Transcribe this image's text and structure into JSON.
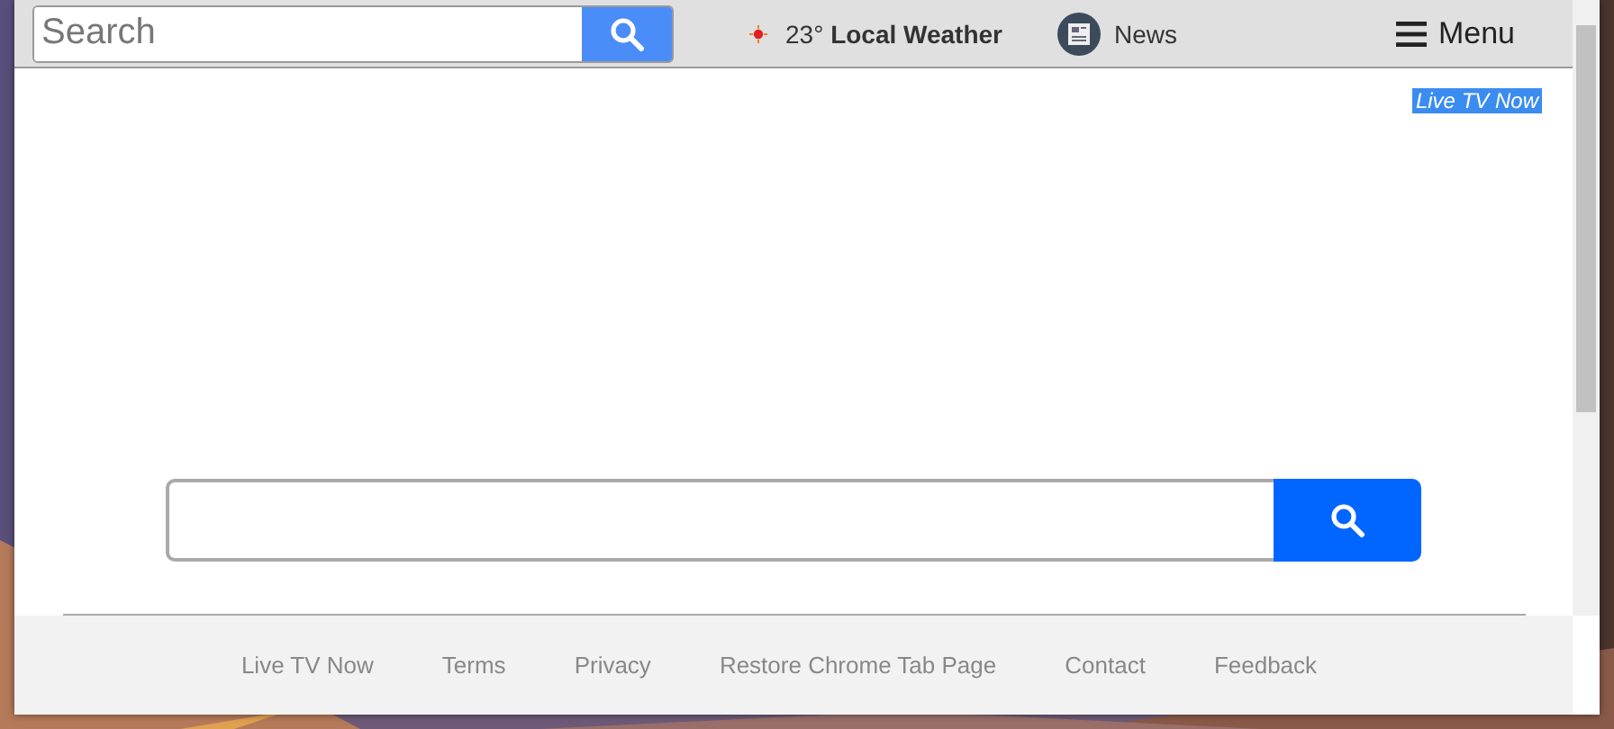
{
  "header": {
    "search": {
      "placeholder": "Search"
    },
    "weather": {
      "temperature": "23°",
      "label": "Local Weather"
    },
    "news": {
      "label": "News"
    },
    "menu": {
      "label": "Menu"
    }
  },
  "promo_link": {
    "label": "Live TV Now",
    "selected": true
  },
  "footer": {
    "links": [
      {
        "label": "Live TV Now"
      },
      {
        "label": "Terms"
      },
      {
        "label": "Privacy"
      },
      {
        "label": "Restore Chrome Tab Page"
      },
      {
        "label": "Contact"
      },
      {
        "label": "Feedback"
      }
    ]
  }
}
